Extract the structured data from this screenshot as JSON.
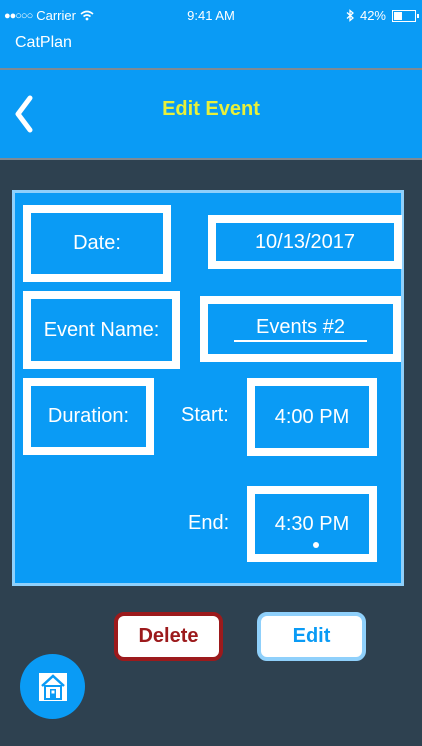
{
  "status_bar": {
    "signal": "●●○○○",
    "carrier": "Carrier",
    "time": "9:41 AM",
    "battery_percent": "42%",
    "battery_level": 0.42
  },
  "app_bar": {
    "title": "CatPlan"
  },
  "nav": {
    "title": "Edit Event",
    "back_icon": "chevron-left-icon",
    "title_color": "#e8f03a"
  },
  "form": {
    "date_label": "Date:",
    "date_value": "10/13/2017",
    "event_name_label": "Event Name:",
    "event_name_value": "Events #2",
    "duration_label": "Duration:",
    "start_label": "Start:",
    "start_value": "4:00 PM",
    "end_label": "End:",
    "end_value": "4:30 PM"
  },
  "actions": {
    "delete_label": "Delete",
    "edit_label": "Edit",
    "delete_color": "#9c1a1c",
    "edit_color": "#0a9bf5"
  },
  "home_button": {
    "icon": "home-icon"
  },
  "colors": {
    "primary": "#0a9bf5",
    "background": "#2e4150"
  }
}
